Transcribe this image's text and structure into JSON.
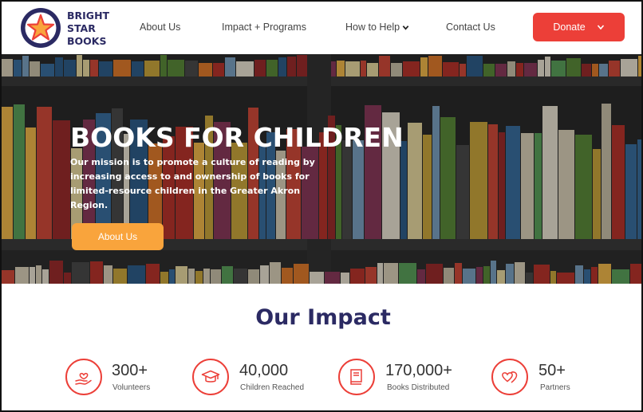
{
  "brand": {
    "line1": "BRIGHT",
    "line2": "STAR",
    "line3": "BOOKS",
    "navy": "#2b2a63",
    "red": "#ec3f38",
    "orange": "#f9a43c"
  },
  "nav": {
    "items": [
      {
        "label": "About Us",
        "dropdown": false
      },
      {
        "label": "Impact + Programs",
        "dropdown": false
      },
      {
        "label": "How to Help",
        "dropdown": true
      },
      {
        "label": "Contact Us",
        "dropdown": false
      }
    ],
    "donate_label": "Donate"
  },
  "hero": {
    "title": "BOOKS FOR CHILDREN",
    "text": "Our mission is to promote a culture of reading by increasing access to and ownership of books for limited-resource children in the Greater Akron Region.",
    "button_label": "About Us"
  },
  "impact": {
    "title": "Our Impact",
    "stats": [
      {
        "value": "300+",
        "label": "Volunteers",
        "icon": "volunteer-hand-heart-icon"
      },
      {
        "value": "40,000",
        "label": "Children Reached",
        "icon": "graduation-cap-icon"
      },
      {
        "value": "170,000+",
        "label": "Books Distributed",
        "icon": "book-icon"
      },
      {
        "value": "50+",
        "label": "Partners",
        "icon": "hearts-icon"
      }
    ]
  }
}
